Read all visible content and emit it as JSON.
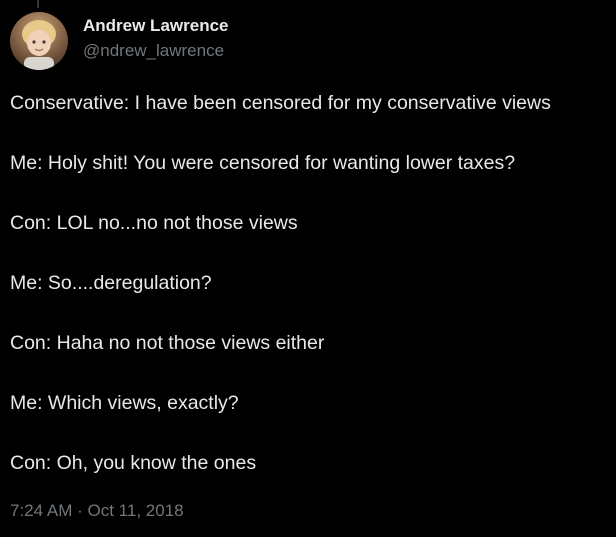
{
  "author": {
    "display_name": "Andrew Lawrence",
    "handle": "@ndrew_lawrence"
  },
  "tweet": {
    "lines": [
      "Conservative: I have been censored for my conservative views",
      "Me: Holy shit! You were censored for wanting lower taxes?",
      "Con: LOL no...no not those views",
      "Me: So....deregulation?",
      "Con: Haha no not those views either",
      "Me: Which views, exactly?",
      "Con: Oh, you know the ones"
    ],
    "time": "7:24 AM",
    "separator": "·",
    "date": "Oct 11, 2018"
  },
  "colors": {
    "background": "#000000",
    "text_primary": "#e7e9ea",
    "text_secondary": "#71767b"
  }
}
